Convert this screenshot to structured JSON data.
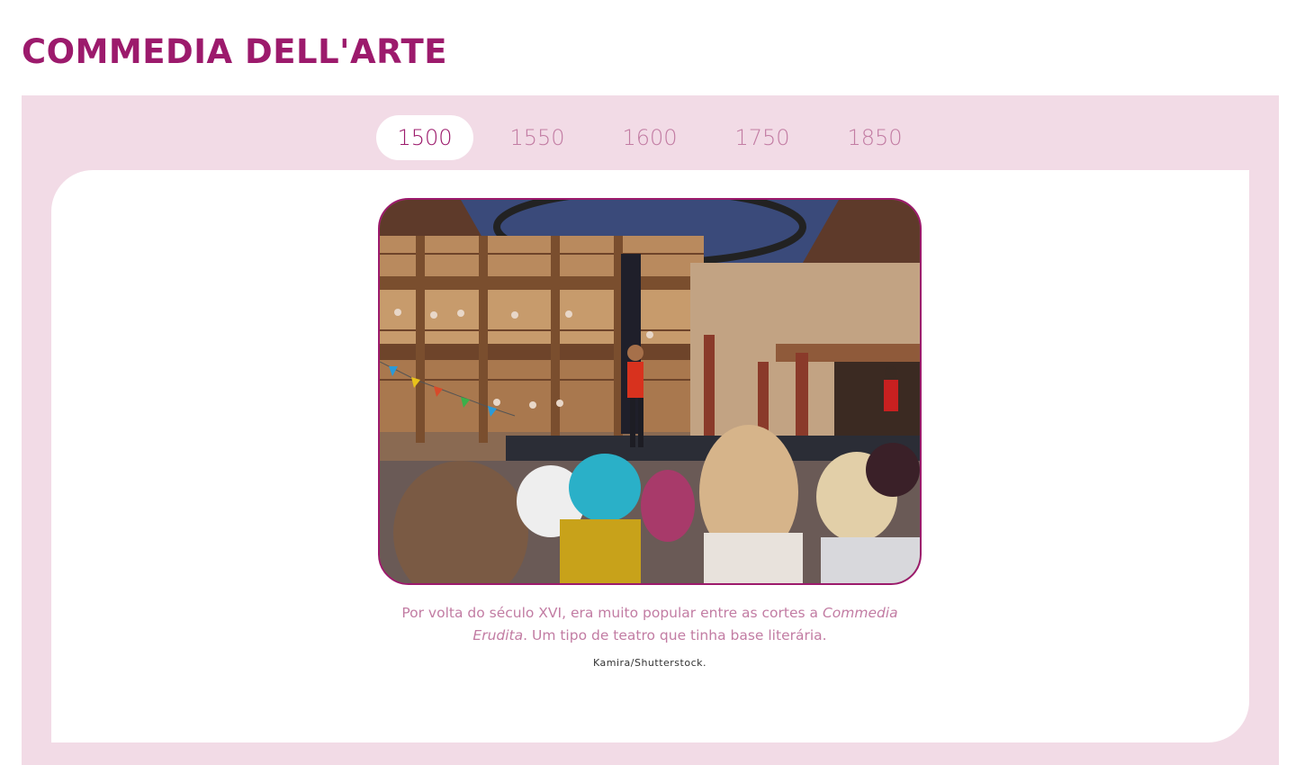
{
  "page": {
    "title": "COMMEDIA DELL'ARTE"
  },
  "timeline": {
    "tabs": [
      {
        "label": "1500",
        "active": true
      },
      {
        "label": "1550",
        "active": false
      },
      {
        "label": "1600",
        "active": false
      },
      {
        "label": "1750",
        "active": false
      },
      {
        "label": "1850",
        "active": false
      }
    ]
  },
  "slide": {
    "caption_part1": "Por volta do século XVI, era muito popular entre as cortes a ",
    "caption_italic": "Commedia Erudita",
    "caption_part2": ". Um tipo de teatro que tinha base literária.",
    "credit": "Kamira/Shutterstock."
  },
  "colors": {
    "title": "#9c1a6c",
    "panel_bg": "#f2dbe6",
    "tab_inactive_text": "#c27ca3",
    "caption_text": "#c27ca3"
  }
}
